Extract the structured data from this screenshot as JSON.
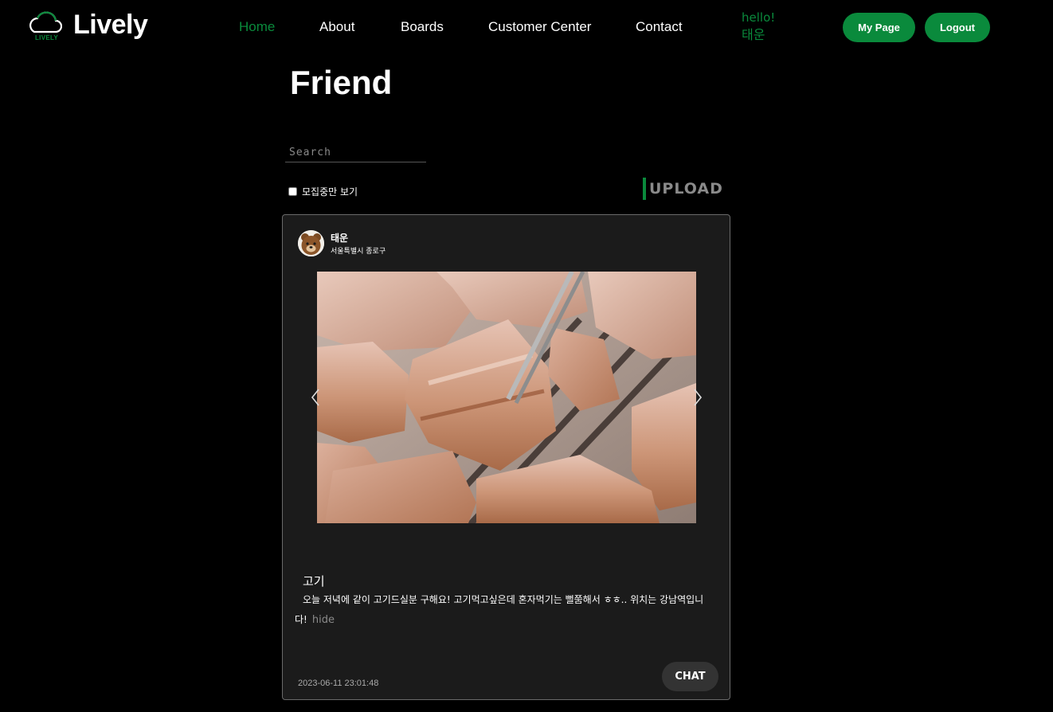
{
  "brand": {
    "name": "Lively",
    "mark_text": "LIVELY"
  },
  "nav": {
    "items": [
      {
        "label": "Home",
        "active": true
      },
      {
        "label": "About",
        "active": false
      },
      {
        "label": "Boards",
        "active": false
      },
      {
        "label": "Customer Center",
        "active": false
      },
      {
        "label": "Contact",
        "active": false
      }
    ]
  },
  "user": {
    "greeting": "hello!",
    "name": "태운"
  },
  "header_buttons": {
    "my_page": "My Page",
    "logout": "Logout"
  },
  "page": {
    "title": "Friend"
  },
  "search": {
    "placeholder": "Search",
    "value": ""
  },
  "filter": {
    "label": "모집중만 보기",
    "checked": false
  },
  "upload": {
    "label": "UPLOAD"
  },
  "post": {
    "author": "태운",
    "location": "서울특별시 종로구",
    "title": "고기",
    "body": "오늘 저녁에 같이 고기드실분 구해요! 고기먹고싶은데 혼자먹기는 뻘쭘해서 ㅎㅎ.. 위치는 강남역입니다!",
    "hide_label": "hide",
    "timestamp": "2023-06-11 23:01:48",
    "chat_label": "CHAT"
  },
  "colors": {
    "accent": "#0a8a3c",
    "background": "#000000",
    "card": "#1b1b1b",
    "muted": "#8a8a8a"
  }
}
